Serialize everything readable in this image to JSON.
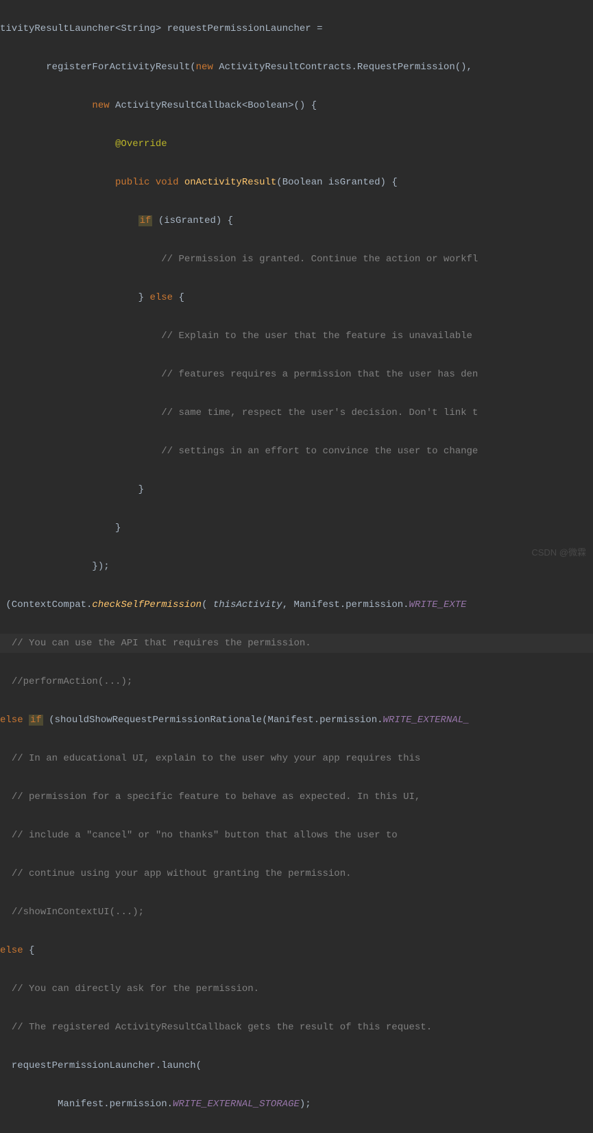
{
  "code": {
    "l1_a": "tivityResultLauncher<String> requestPermissionLauncher =",
    "l2_a": "        registerForActivityResult(",
    "l2_new": "new",
    "l2_b": " ActivityResultContracts.RequestPermission(),",
    "l3_a": "                ",
    "l3_new": "new",
    "l3_b": " ActivityResultCallback<Boolean>() {",
    "l4_a": "                    ",
    "l4_override": "@Override",
    "l5_a": "                    ",
    "l5_public": "public",
    "l5_sp1": " ",
    "l5_void": "void",
    "l5_sp2": " ",
    "l5_method": "onActivityResult",
    "l5_b": "(Boolean isGranted) {",
    "l6_a": "                        ",
    "l6_if": "if",
    "l6_b": " (isGranted) {",
    "l7_a": "                            ",
    "l7_c": "// Permission is granted. Continue the action or workfl",
    "l8_a": "                        } ",
    "l8_else": "else",
    "l8_b": " {",
    "l9_a": "                            ",
    "l9_c": "// Explain to the user that the feature is unavailable ",
    "l10_a": "                            ",
    "l10_c": "// features requires a permission that the user has den",
    "l11_a": "                            ",
    "l11_c": "// same time, respect the user's decision. Don't link t",
    "l12_a": "                            ",
    "l12_c": "// settings in an effort to convince the user to change",
    "l13_a": "                        }",
    "l14_a": "                    }",
    "l15_a": "                });",
    "l16_a": " (ContextCompat.",
    "l16_m": "checkSelfPermission",
    "l16_b": "( ",
    "l16_this": "thisActivity",
    "l16_c": ", Manifest.permission.",
    "l16_const": "WRITE_EXTE",
    "l17_a": "  ",
    "l17_c": "// You can use the API that requires the permission.",
    "l18_a": "  ",
    "l18_c": "//performAction(...);",
    "l19_else": "else",
    "l19_sp": " ",
    "l19_if": "if",
    "l19_b": " (shouldShowRequestPermissionRationale(Manifest.permission.",
    "l19_const": "WRITE_EXTERNAL_",
    "l20_a": "  ",
    "l20_c": "// In an educational UI, explain to the user why your app requires this",
    "l21_a": "  ",
    "l21_c": "// permission for a specific feature to behave as expected. In this UI,",
    "l22_a": "  ",
    "l22_c": "// include a \"cancel\" or \"no thanks\" button that allows the user to",
    "l23_a": "  ",
    "l23_c": "// continue using your app without granting the permission.",
    "l24_a": "  ",
    "l24_c": "//showInContextUI(...);",
    "l25_else": "else",
    "l25_b": " {",
    "l26_a": "  ",
    "l26_c": "// You can directly ask for the permission.",
    "l27_a": "  ",
    "l27_c": "// The registered ActivityResultCallback gets the result of this request.",
    "l28_a": "  requestPermissionLauncher.launch(",
    "l29_a": "          Manifest.permission.",
    "l29_const": "WRITE_EXTERNAL_STORAGE",
    "l29_b": ");"
  },
  "watermark": "CSDN @微霖"
}
